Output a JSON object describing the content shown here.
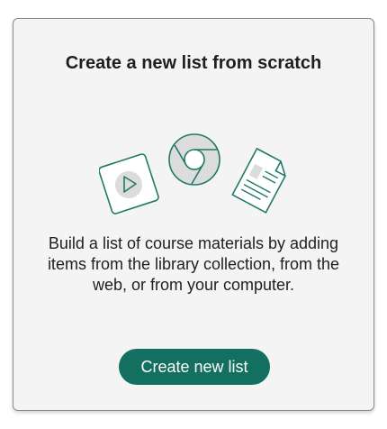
{
  "card": {
    "title": "Create a new list from scratch",
    "description": "Build a list of course materials by adding items from the library collection, from the web, or from your computer.",
    "button_label": "Create new list"
  },
  "illustration": {
    "icons": [
      "video-play-icon",
      "web-browser-icon",
      "document-icon"
    ]
  },
  "colors": {
    "accent": "#136f5f",
    "icon_stroke": "#1f7a66",
    "icon_fill": "#ffffff",
    "icon_inner": "#dcdcdc",
    "card_background": "#f4f4f4",
    "card_border": "#8a8a8a",
    "text": "#1f1f1f"
  }
}
